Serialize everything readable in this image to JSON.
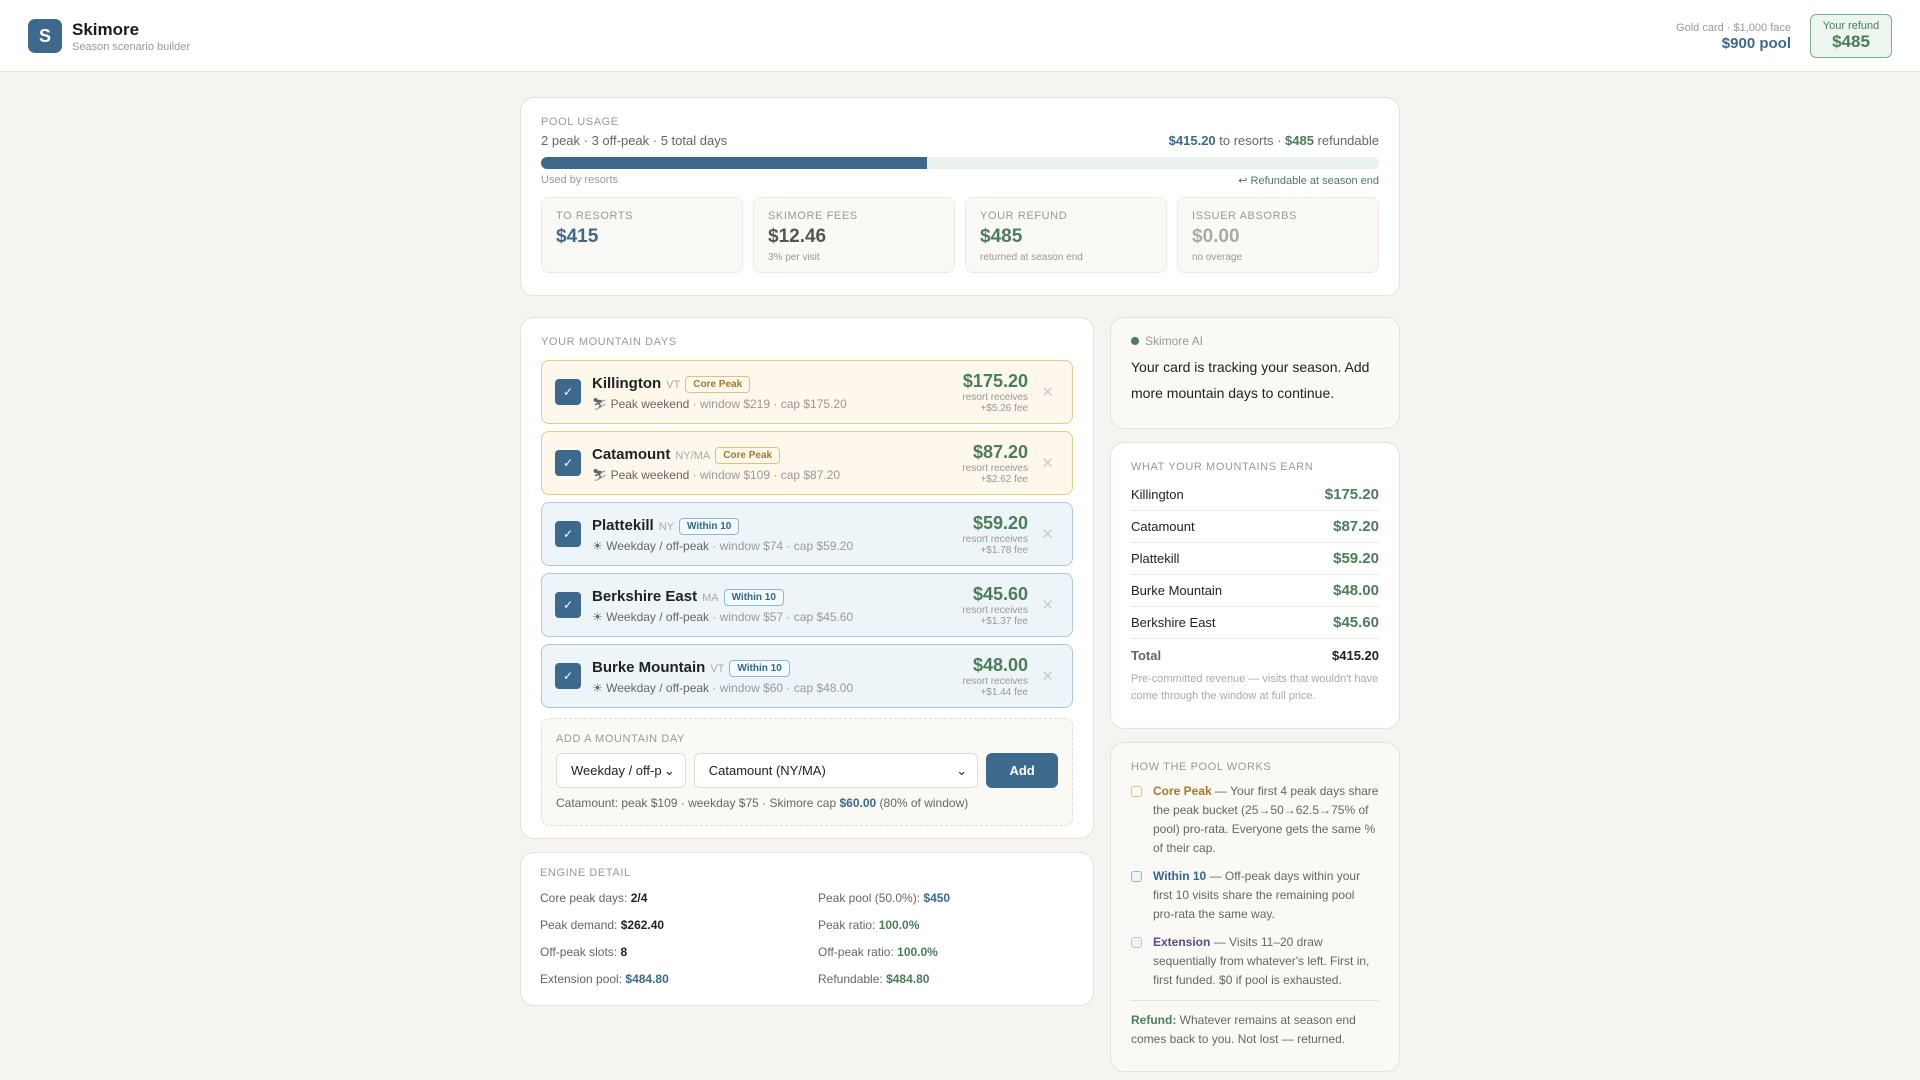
{
  "header": {
    "logo_letter": "S",
    "title": "Skimore",
    "subtitle": "Season scenario builder",
    "card_line": "Gold card · $1,000 face",
    "pool": "$900 pool",
    "refund_label": "Your refund",
    "refund_value": "$485"
  },
  "pool": {
    "label": "Pool usage",
    "summary": "2 peak · 3 off-peak · 5 total days",
    "to_resorts": "$415.20",
    "to_resorts_suffix": " to resorts · ",
    "refundable": "$485",
    "refundable_suffix": " refundable",
    "used_fraction": 0.461,
    "used_label": "Used by resorts",
    "refund_note": "↩ Refundable at season end",
    "stats": [
      {
        "label": "To resorts",
        "value": "$415",
        "note": ""
      },
      {
        "label": "Skimore fees",
        "value": "$12.46",
        "note": "3% per visit"
      },
      {
        "label": "Your refund",
        "value": "$485",
        "note": "returned at season end"
      },
      {
        "label": "Issuer absorbs",
        "value": "$0.00",
        "note": "no overage"
      }
    ]
  },
  "days": {
    "label": "Your mountain days",
    "items": [
      {
        "name": "Killington",
        "state": "VT",
        "badge": "Core Peak",
        "type": "Peak weekend",
        "detail": " · window $219 · cap $175.20",
        "amount": "$175.20",
        "receives": "resort receives",
        "fee": "+$5.26 fee"
      },
      {
        "name": "Catamount",
        "state": "NY/MA",
        "badge": "Core Peak",
        "type": "Peak weekend",
        "detail": " · window $109 · cap $87.20",
        "amount": "$87.20",
        "receives": "resort receives",
        "fee": "+$2.62 fee"
      },
      {
        "name": "Plattekill",
        "state": "NY",
        "badge": "Within 10",
        "type": "Weekday / off-peak",
        "detail": " · window $74 · cap $59.20",
        "amount": "$59.20",
        "receives": "resort receives",
        "fee": "+$1.78 fee"
      },
      {
        "name": "Berkshire East",
        "state": "MA",
        "badge": "Within 10",
        "type": "Weekday / off-peak",
        "detail": " · window $57 · cap $45.60",
        "amount": "$45.60",
        "receives": "resort receives",
        "fee": "+$1.37 fee"
      },
      {
        "name": "Burke Mountain",
        "state": "VT",
        "badge": "Within 10",
        "type": "Weekday / off-peak",
        "detail": " · window $60 · cap $48.00",
        "amount": "$48.00",
        "receives": "resort receives",
        "fee": "+$1.44 fee"
      }
    ],
    "add": {
      "label": "Add a mountain day",
      "day_type": "Weekday / off-p",
      "resort": "Catamount (NY/MA)",
      "button": "Add",
      "hint_prefix": "Catamount: peak $109 · weekday $75 · Skimore cap ",
      "hint_cap": "$60.00",
      "hint_suffix": " (80% of window)"
    }
  },
  "engine": {
    "label": "Engine detail",
    "rows": [
      {
        "k": "Core peak days: ",
        "v": "2/4"
      },
      {
        "k": "Peak pool (50.0%): ",
        "v": "$450"
      },
      {
        "k": "Peak demand: ",
        "v": "$262.40"
      },
      {
        "k": "Peak ratio: ",
        "v": "100.0%"
      },
      {
        "k": "Off-peak slots: ",
        "v": "8"
      },
      {
        "k": "Off-peak ratio: ",
        "v": "100.0%"
      },
      {
        "k": "Extension pool: ",
        "v": "$484.80"
      },
      {
        "k": "Refundable: ",
        "v": "$484.80"
      }
    ]
  },
  "ai": {
    "label": "Skimore AI",
    "message": "Your card is tracking your season. Add more mountain days to continue."
  },
  "earn": {
    "label": "What your mountains earn",
    "rows": [
      {
        "k": "Killington",
        "v": "$175.20"
      },
      {
        "k": "Catamount",
        "v": "$87.20"
      },
      {
        "k": "Plattekill",
        "v": "$59.20"
      },
      {
        "k": "Burke Mountain",
        "v": "$48.00"
      },
      {
        "k": "Berkshire East",
        "v": "$45.60"
      }
    ],
    "total_label": "Total",
    "total": "$415.20",
    "note": "Pre-committed revenue — visits that wouldn't have come through the window at full price."
  },
  "how": {
    "label": "How the pool works",
    "items": [
      {
        "title": "Core Peak",
        "text": " — Your first 4 peak days share the peak bucket (25→50→62.5→75% of pool) pro-rata. Everyone gets the same % of their cap."
      },
      {
        "title": "Within 10",
        "text": " — Off-peak days within your first 10 visits share the remaining pool pro-rata the same way."
      },
      {
        "title": "Extension",
        "text": " — Visits 11–20 draw sequentially from whatever's left. First in, first funded. $0 if pool is exhausted."
      }
    ],
    "refund_title": "Refund:",
    "refund_text": " Whatever remains at season end comes back to you. Not lost — returned."
  },
  "colors": {
    "accent": "#3d6a8c",
    "green": "#4b7d5a",
    "peak": "#a57a2b",
    "within": "#2e6a8d",
    "extension": "#5b4a8f"
  }
}
